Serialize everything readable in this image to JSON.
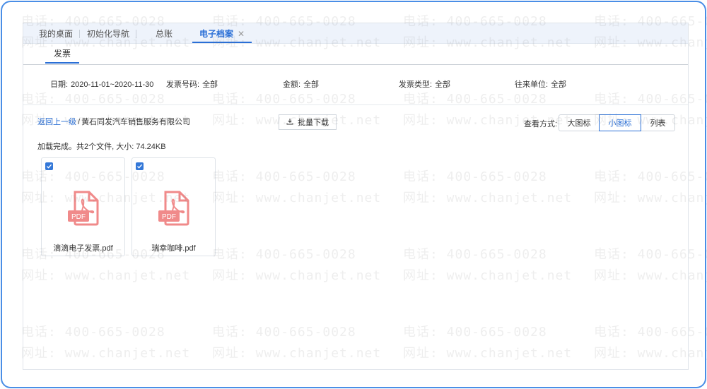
{
  "top_tabs": [
    {
      "label": "我的桌面"
    },
    {
      "label": "初始化导航"
    },
    {
      "label": "总账"
    },
    {
      "label": "电子档案",
      "close": "✕"
    }
  ],
  "sub_tab": "发票",
  "filters": [
    {
      "label": "日期:",
      "value": "2020-11-01~2020-11-30"
    },
    {
      "label": "发票号码:",
      "value": "全部"
    },
    {
      "label": "金额:",
      "value": "全部"
    },
    {
      "label": "发票类型:",
      "value": "全部"
    },
    {
      "label": "往来单位:",
      "value": "全部"
    }
  ],
  "breadcrumb": {
    "back": "返回上一级",
    "separator": "/",
    "current": "黄石同发汽车销售服务有限公司"
  },
  "batch_download": "批量下载",
  "view": {
    "label": "查看方式:",
    "options": [
      "大图标",
      "小图标",
      "列表"
    ],
    "selected": "小图标"
  },
  "status": "加载完成。共2个文件, 大小: 74.24KB",
  "files": [
    {
      "name": "滴滴电子发票.pdf",
      "checked": true,
      "icon": "pdf-icon"
    },
    {
      "name": "瑞幸咖啡.pdf",
      "checked": true,
      "icon": "pdf-icon"
    }
  ],
  "watermark": {
    "phone": "电话: 400-665-0028",
    "site": "网址: www.chanjet.net"
  },
  "colors": {
    "accent": "#2a6fd6",
    "frame": "#4a8ee6",
    "pdf": "#f08a8a"
  }
}
